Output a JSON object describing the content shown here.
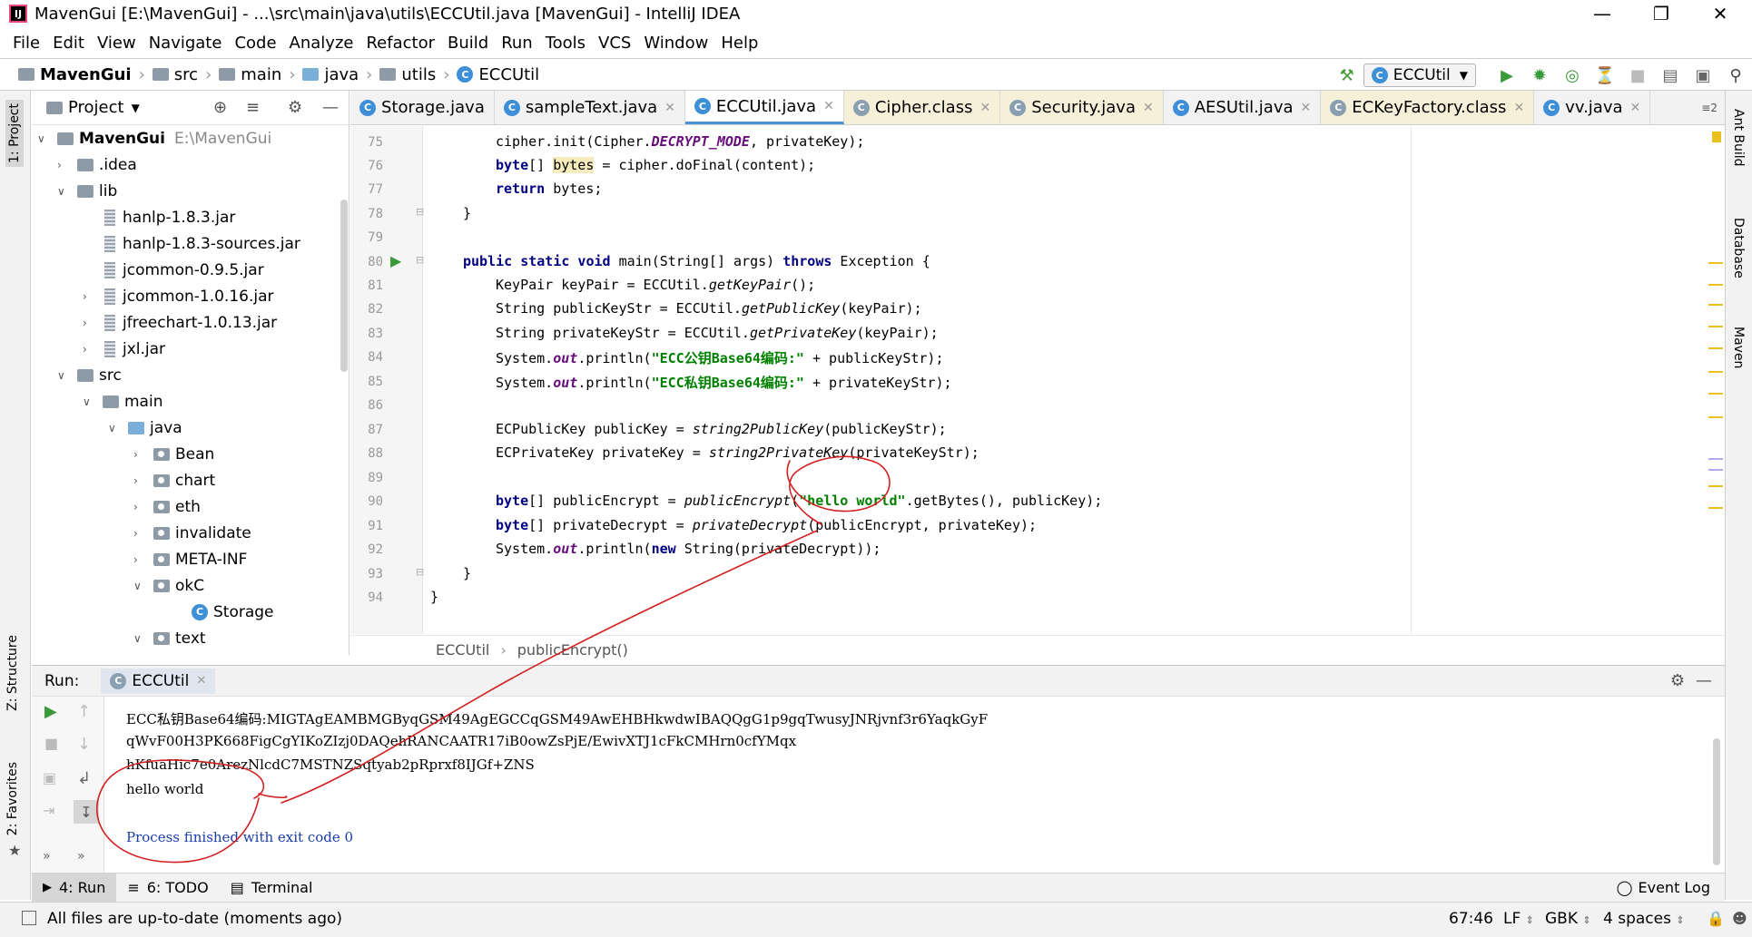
{
  "window": {
    "title": "MavenGui [E:\\MavenGui] - ...\\src\\main\\java\\utils\\ECCUtil.java [MavenGui] - IntelliJ IDEA"
  },
  "menu": [
    "File",
    "Edit",
    "View",
    "Navigate",
    "Code",
    "Analyze",
    "Refactor",
    "Build",
    "Run",
    "Tools",
    "VCS",
    "Window",
    "Help"
  ],
  "nav": {
    "crumbs": [
      "MavenGui",
      "src",
      "main",
      "java",
      "utils",
      "ECCUtil"
    ],
    "run_config": "ECCUtil"
  },
  "project_panel": {
    "title": "Project",
    "tree": [
      {
        "label": "MavenGui",
        "hint": "E:\\MavenGui"
      },
      {
        "label": ".idea"
      },
      {
        "label": "lib"
      },
      {
        "label": "hanlp-1.8.3.jar"
      },
      {
        "label": "hanlp-1.8.3-sources.jar"
      },
      {
        "label": "jcommon-0.9.5.jar"
      },
      {
        "label": "jcommon-1.0.16.jar"
      },
      {
        "label": "jfreechart-1.0.13.jar"
      },
      {
        "label": "jxl.jar"
      },
      {
        "label": "src"
      },
      {
        "label": "main"
      },
      {
        "label": "java"
      },
      {
        "label": "Bean"
      },
      {
        "label": "chart"
      },
      {
        "label": "eth"
      },
      {
        "label": "invalidate"
      },
      {
        "label": "META-INF"
      },
      {
        "label": "okC"
      },
      {
        "label": "Storage"
      },
      {
        "label": "text"
      }
    ]
  },
  "left_tool_tabs": [
    "1: Project",
    "Z: Structure",
    "2: Favorites"
  ],
  "right_tool_tabs": [
    "Ant Build",
    "Database",
    "Maven"
  ],
  "editor_tabs": [
    "Storage.java",
    "sampleText.java",
    "ECCUtil.java",
    "Cipher.class",
    "Security.java",
    "AESUtil.java",
    "ECKeyFactory.class",
    "vv.java"
  ],
  "tab_overflow": "2",
  "code": {
    "lines": [
      "75",
      "76",
      "77",
      "78",
      "79",
      "80",
      "81",
      "82",
      "83",
      "84",
      "85",
      "86",
      "87",
      "88",
      "89",
      "90",
      "91",
      "92",
      "93",
      "94"
    ],
    "t75a": "cipher.init(Cipher.",
    "t75b": "DECRYPT_MODE",
    "t75c": ", privateKey);",
    "t76a": "byte",
    "t76b": "[] ",
    "t76c": "bytes",
    "t76d": " = cipher.doFinal(content);",
    "t77a": "return",
    "t77b": " bytes;",
    "t78": "}",
    "t80a": "public static void",
    "t80b": " main(String[] args) ",
    "t80c": "throws",
    "t80d": " Exception {",
    "t81a": "KeyPair keyPair = ECCUtil.",
    "t81b": "getKeyPair",
    "t81c": "();",
    "t82a": "String publicKeyStr = ECCUtil.",
    "t82b": "getPublicKey",
    "t82c": "(keyPair);",
    "t83a": "String privateKeyStr = ECCUtil.",
    "t83b": "getPrivateKey",
    "t83c": "(keyPair);",
    "t84a": "System.",
    "t84b": "out",
    "t84c": ".println(",
    "t84d": "\"ECC公钥Base64编码:\"",
    "t84e": " + publicKeyStr);",
    "t85a": "System.",
    "t85b": "out",
    "t85c": ".println(",
    "t85d": "\"ECC私钥Base64编码:\"",
    "t85e": " + privateKeyStr);",
    "t87a": "ECPublicKey publicKey = ",
    "t87b": "string2PublicKey",
    "t87c": "(publicKeyStr);",
    "t88a": "ECPrivateKey privateKey = ",
    "t88b": "string2PrivateKey",
    "t88c": "(privateKeyStr);",
    "t90a": "byte",
    "t90b": "[] publicEncrypt = ",
    "t90c": "publicEncrypt",
    "t90d": "(",
    "t90e": "\"hello world\"",
    "t90f": ".getBytes(), publicKey);",
    "t91a": "byte",
    "t91b": "[] privateDecrypt = ",
    "t91c": "privateDecrypt",
    "t91d": "(publicEncrypt, privateKey);",
    "t92a": "System.",
    "t92b": "out",
    "t92c": ".println(",
    "t92d": "new",
    "t92e": " String(privateDecrypt));",
    "t93": "}",
    "t94": "}"
  },
  "breadcrumbs": [
    "ECCUtil",
    "publicEncrypt()"
  ],
  "run": {
    "label": "Run:",
    "tab": "ECCUtil",
    "output": [
      "ECC私钥Base64编码:MIGTAgEAMBMGByqGSM49AgEGCCqGSM49AwEHBHkwdwIBAQQgG1p9gqTwusyJNRjvnf3r6YaqkGyF",
      "qWvF00H3PK668FigCgYIKoZIzj0DAQehRANCAATR17iB0owZsPjE/EwivXTJ1cFkCMHrn0cfYMqx",
      "hKfuaHic7e0ArezNlcdC7MSTNZSqtyab2pRprxf8IJGf+ZNS",
      "hello world",
      "",
      "Process finished with exit code 0"
    ]
  },
  "bottom_tabs": [
    "4: Run",
    "6: TODO",
    "Terminal"
  ],
  "event_log": "Event Log",
  "status": {
    "message": "All files are up-to-date (moments ago)",
    "position": "67:46",
    "line_sep": "LF",
    "encoding": "GBK",
    "indent": "4 spaces"
  },
  "colors": {
    "accent": "#4b8fd8",
    "keyword": "#000080",
    "string": "#008000",
    "annotation": "#d02020"
  }
}
